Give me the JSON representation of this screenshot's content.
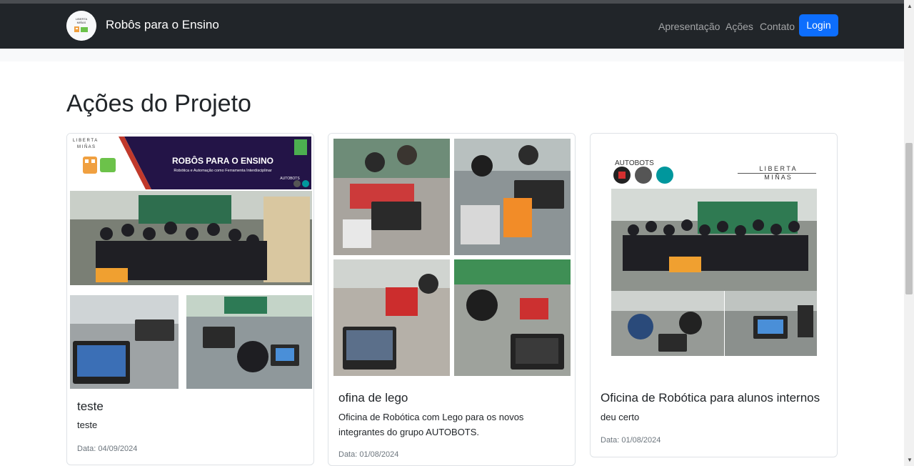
{
  "navbar": {
    "brand": "Robôs para o Ensino",
    "logo_text_top": "LIBERTA",
    "logo_text_bottom": "MIÑAS",
    "links": [
      "Apresentação",
      "Ações",
      "Contato"
    ],
    "login_label": "Login"
  },
  "page": {
    "title": "Ações do Projeto"
  },
  "cards": [
    {
      "banner_brand_top": "L I B E R T A",
      "banner_brand_bottom": "M I Ñ A S",
      "banner_title": "ROBÔS PARA O ENSINO",
      "banner_subtitle": "Robótica e Automação como Ferramenta Interdisciplinar",
      "banner_tag": "AUTOBOTS",
      "title": "teste",
      "text": "teste",
      "date": "Data: 04/09/2024"
    },
    {
      "title": "ofina de lego",
      "text": "Oficina de Robótica com Lego para os novos integrantes do grupo AUTOBOTS.",
      "date": "Data: 01/08/2024"
    },
    {
      "collage_left_label": "AUTOBOTS",
      "collage_brand_top": "L I B E R T A",
      "collage_brand_bottom": "M I Ñ A S",
      "title": "Oficina de Robótica para alunos internos",
      "text": "deu certo",
      "date": "Data: 01/08/2024"
    }
  ],
  "colors": {
    "navbar_bg": "#212529",
    "primary": "#0d6efd",
    "muted": "#6c757d"
  },
  "icons": [
    "scroll-up-icon",
    "scroll-down-icon"
  ]
}
